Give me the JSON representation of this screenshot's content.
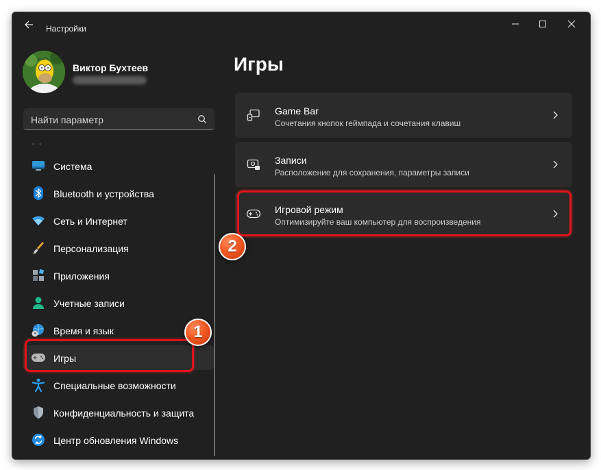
{
  "window": {
    "title": "Настройки"
  },
  "profile": {
    "name": "Виктор Бухтеев",
    "email": "••••••••••••••••"
  },
  "search": {
    "placeholder": "Найти параметр"
  },
  "sidebar": {
    "items": [
      {
        "label": "Система",
        "icon": "monitor-icon"
      },
      {
        "label": "Bluetooth и устройства",
        "icon": "bluetooth-icon"
      },
      {
        "label": "Сеть и Интернет",
        "icon": "wifi-icon"
      },
      {
        "label": "Персонализация",
        "icon": "brush-icon"
      },
      {
        "label": "Приложения",
        "icon": "apps-icon"
      },
      {
        "label": "Учетные записи",
        "icon": "person-icon"
      },
      {
        "label": "Время и язык",
        "icon": "globe-clock-icon"
      },
      {
        "label": "Игры",
        "icon": "gamepad-icon",
        "selected": true
      },
      {
        "label": "Специальные возможности",
        "icon": "accessibility-icon"
      },
      {
        "label": "Конфиденциальность и защита",
        "icon": "shield-icon"
      },
      {
        "label": "Центр обновления Windows",
        "icon": "update-icon"
      }
    ]
  },
  "main": {
    "title": "Игры",
    "cards": [
      {
        "title": "Game Bar",
        "subtitle": "Сочетания кнопок геймпада и сочетания клавиш",
        "icon": "game-bar-icon"
      },
      {
        "title": "Записи",
        "subtitle": "Расположение для сохранения, параметры записи",
        "icon": "capture-icon"
      },
      {
        "title": "Игровой режим",
        "subtitle": "Оптимизируйте ваш компьютер для воспроизведения",
        "icon": "game-mode-icon"
      }
    ]
  },
  "annotations": {
    "step1": "1",
    "step2": "2",
    "highlight_color": "#e0141b",
    "badge_color": "#f05a22"
  },
  "colors": {
    "background": "#202020",
    "card": "#2b2b2b",
    "selected": "#2d2d2d",
    "accent_blue": "#4cc2ff"
  }
}
